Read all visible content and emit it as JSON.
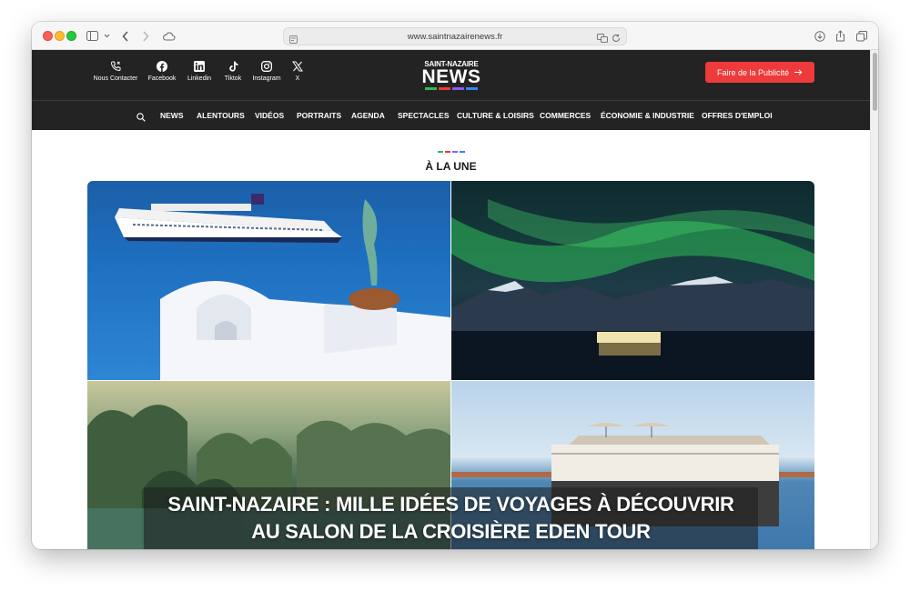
{
  "browser": {
    "url": "www.saintnazairenews.fr"
  },
  "header": {
    "social": [
      {
        "label": "Nous Contacter",
        "icon": "phone-icon"
      },
      {
        "label": "Facebook",
        "icon": "facebook-icon"
      },
      {
        "label": "Linkedin",
        "icon": "linkedin-icon"
      },
      {
        "label": "Tiktok",
        "icon": "tiktok-icon"
      },
      {
        "label": "Instagram",
        "icon": "instagram-icon"
      },
      {
        "label": "X",
        "icon": "x-icon"
      }
    ],
    "logo_top": "SAINT-NAZAIRE",
    "logo_main": "NEWS",
    "logo_colors": [
      "#2ebd59",
      "#ee3a3a",
      "#8b5cf6",
      "#3b82f6"
    ],
    "cta_label": "Faire de la Publicité",
    "cta_color": "#ee3a3a"
  },
  "nav": {
    "items": [
      "NEWS",
      "ALENTOURS",
      "VIDÉOS",
      "PORTRAITS",
      "AGENDA",
      "SPECTACLES",
      "CULTURE & LOISIRS",
      "COMMERCES",
      "ÉCONOMIE & INDUSTRIE",
      "OFFRES D'EMPLOI"
    ]
  },
  "section": {
    "title": "À LA UNE"
  },
  "featured": {
    "headline_line1": "SAINT-NAZAIRE : MILLE IDÉES DE VOYAGES À DÉCOUVRIR",
    "headline_line2": "AU SALON DE LA CROISIÈRE EDEN TOUR"
  }
}
